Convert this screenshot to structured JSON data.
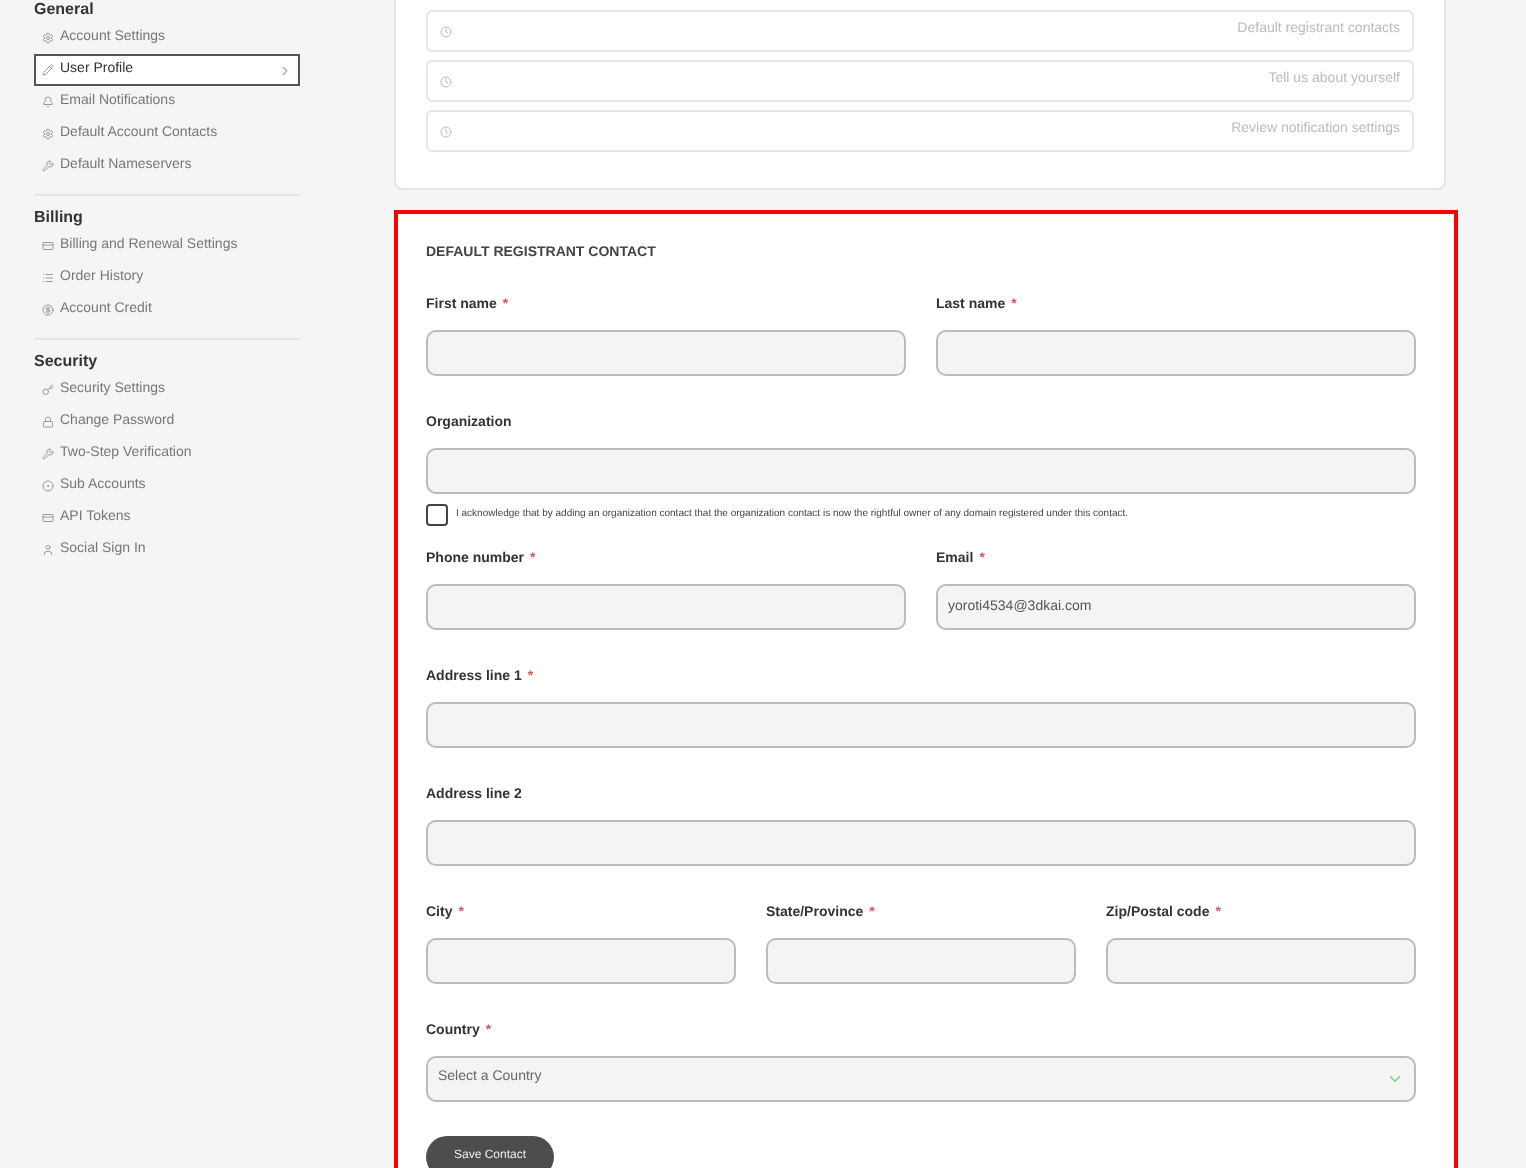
{
  "sidebar": {
    "sections": [
      {
        "title": "General",
        "items": [
          {
            "label": "Account Settings",
            "selected": false
          },
          {
            "label": "User Profile",
            "selected": true
          },
          {
            "label": "Email Notifications",
            "selected": false
          },
          {
            "label": "Default Account Contacts",
            "selected": false
          },
          {
            "label": "Default Nameservers",
            "selected": false
          }
        ]
      },
      {
        "title": "Billing",
        "items": [
          {
            "label": "Billing and Renewal Settings",
            "selected": false
          },
          {
            "label": "Order History",
            "selected": false
          },
          {
            "label": "Account Credit",
            "selected": false
          }
        ]
      },
      {
        "title": "Security",
        "items": [
          {
            "label": "Security Settings",
            "selected": false
          },
          {
            "label": "Change Password",
            "selected": false
          },
          {
            "label": "Two-Step Verification",
            "selected": false
          },
          {
            "label": "Sub Accounts",
            "selected": false
          },
          {
            "label": "API Tokens",
            "selected": false
          },
          {
            "label": "Social Sign In",
            "selected": false
          }
        ]
      }
    ]
  },
  "checklist": [
    {
      "label": "Default registrant contacts"
    },
    {
      "label": "Tell us about yourself"
    },
    {
      "label": "Review notification settings"
    }
  ],
  "form": {
    "title": "DEFAULT REGISTRANT CONTACT",
    "items": [
      {
        "kind": "fields",
        "fields": [
          {
            "kind": "text",
            "label": "First name",
            "required_mark": "*"
          },
          {
            "kind": "text",
            "label": "Last name",
            "required_mark": "*"
          }
        ]
      },
      {
        "kind": "fields",
        "fields": [
          {
            "kind": "text",
            "label": "Organization"
          }
        ]
      },
      {
        "kind": "checkbox",
        "label": "I acknowledge that by adding an organization contact that the organization contact is now the rightful owner of any domain registered under this contact.",
        "checked": false
      },
      {
        "kind": "fields",
        "fields": [
          {
            "kind": "text",
            "label": "Phone number",
            "required_mark": "*"
          },
          {
            "kind": "text",
            "label": "Email",
            "required_mark": "*",
            "value": "yoroti4534@3dkai.com"
          }
        ]
      },
      {
        "kind": "fields",
        "fields": [
          {
            "kind": "text",
            "label": "Address line 1",
            "required_mark": "*"
          }
        ]
      },
      {
        "kind": "fields",
        "fields": [
          {
            "kind": "text",
            "label": "Address line 2"
          }
        ]
      },
      {
        "kind": "fields",
        "fields": [
          {
            "kind": "text",
            "label": "City",
            "required_mark": "*"
          },
          {
            "kind": "text",
            "label": "State/Province",
            "required_mark": "*"
          },
          {
            "kind": "text",
            "label": "Zip/Postal code",
            "required_mark": "*"
          }
        ]
      },
      {
        "kind": "fields",
        "fields": [
          {
            "kind": "select",
            "label": "Country",
            "required_mark": "*",
            "placeholder": "Select a Country"
          }
        ]
      }
    ],
    "button": "Save Contact"
  }
}
